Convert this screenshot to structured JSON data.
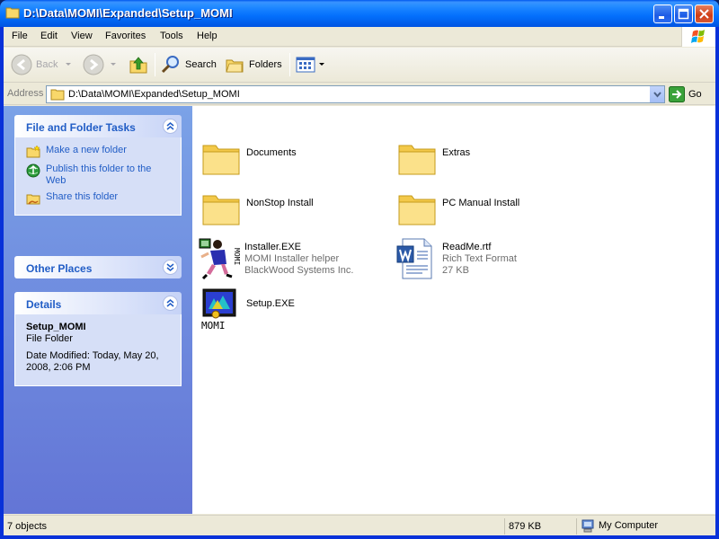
{
  "window": {
    "title": "D:\\Data\\MOMI\\Expanded\\Setup_MOMI"
  },
  "menubar": {
    "items": [
      "File",
      "Edit",
      "View",
      "Favorites",
      "Tools",
      "Help"
    ]
  },
  "toolbar": {
    "back_label": "Back",
    "search_label": "Search",
    "folders_label": "Folders"
  },
  "addressbar": {
    "label": "Address",
    "value": "D:\\Data\\MOMI\\Expanded\\Setup_MOMI",
    "go_label": "Go"
  },
  "taskpane": {
    "file_tasks": {
      "title": "File and Folder Tasks",
      "items": [
        "Make a new folder",
        "Publish this folder to the Web",
        "Share this folder"
      ]
    },
    "other_places": {
      "title": "Other Places"
    },
    "details": {
      "title": "Details",
      "name": "Setup_MOMI",
      "type": "File Folder",
      "modified": "Date Modified: Today, May 20, 2008, 2:06 PM"
    }
  },
  "files": [
    {
      "name": "Documents",
      "icon": "folder-icon"
    },
    {
      "name": "Extras",
      "icon": "folder-icon"
    },
    {
      "name": "NonStop Install",
      "icon": "folder-icon"
    },
    {
      "name": "PC Manual Install",
      "icon": "folder-icon"
    },
    {
      "name": "Installer.EXE",
      "line2": "MOMI Installer helper",
      "line3": "BlackWood Systems Inc.",
      "icon": "installer-icon"
    },
    {
      "name": "ReadMe.rtf",
      "line2": "Rich Text Format",
      "line3": "27 KB",
      "icon": "word-document-icon"
    },
    {
      "name": "Setup.EXE",
      "icon": "setup-momi-icon",
      "icon_label": "MOMI"
    }
  ],
  "installer_icon_label": "MOMI",
  "statusbar": {
    "objects": "7 objects",
    "size": "879 KB",
    "location": "My Computer"
  },
  "colors": {
    "titlebar": "#0054e3",
    "taskpane": "#6f8de0",
    "link": "#215dc6",
    "status_bg": "#ece9d8"
  }
}
